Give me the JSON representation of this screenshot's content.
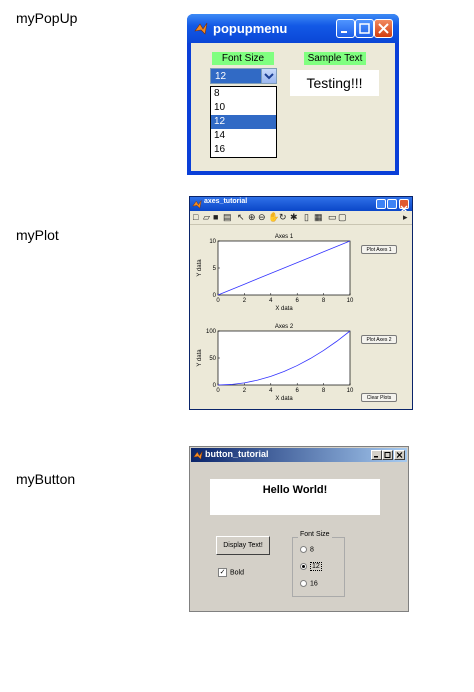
{
  "labels": {
    "popup": "myPopUp",
    "plot": "myPlot",
    "button": "myButton"
  },
  "popup_window": {
    "title": "popupmenu",
    "font_size_label": "Font Size",
    "sample_text_label": "Sample Text",
    "selected_value": "12",
    "options": [
      "8",
      "10",
      "12",
      "14",
      "16"
    ],
    "selected_index": 2,
    "sample_text": "Testing!!!"
  },
  "axes_window": {
    "title": "axes_tutorial",
    "axes1": {
      "title": "Axes 1",
      "xlabel": "X data",
      "ylabel": "Y data"
    },
    "axes2": {
      "title": "Axes 2",
      "xlabel": "X data",
      "ylabel": "Y data"
    },
    "buttons": {
      "plot1": "Plot Axes 1",
      "plot2": "Plot Axes 2",
      "clear": "Clear Plots"
    }
  },
  "chart_data": [
    {
      "type": "line",
      "title": "Axes 1",
      "xlabel": "X data",
      "ylabel": "Y data",
      "x": [
        0,
        1,
        2,
        3,
        4,
        5,
        6,
        7,
        8,
        9,
        10
      ],
      "series": [
        {
          "values": [
            0,
            1,
            2,
            3,
            4,
            5,
            6,
            7,
            8,
            9,
            10
          ]
        }
      ],
      "xlim": [
        0,
        10
      ],
      "ylim": [
        0,
        10
      ],
      "xticks": [
        0,
        2,
        4,
        6,
        8,
        10
      ],
      "yticks": [
        0,
        5,
        10
      ],
      "color": "#3333ff"
    },
    {
      "type": "line",
      "title": "Axes 2",
      "xlabel": "X data",
      "ylabel": "Y data",
      "x": [
        0,
        1,
        2,
        3,
        4,
        5,
        6,
        7,
        8,
        9,
        10
      ],
      "series": [
        {
          "values": [
            0,
            1,
            4,
            9,
            16,
            25,
            36,
            49,
            64,
            81,
            100
          ]
        }
      ],
      "xlim": [
        0,
        10
      ],
      "ylim": [
        0,
        100
      ],
      "xticks": [
        0,
        2,
        4,
        6,
        8,
        10
      ],
      "yticks": [
        0,
        50,
        100
      ],
      "color": "#3333ff"
    }
  ],
  "button_window": {
    "title": "button_tutorial",
    "hello_text": "Hello World!",
    "display_button": "Display Text!",
    "bold_label": "Bold",
    "bold_checked": true,
    "font_size_group": "Font Size",
    "radio_options": [
      "8",
      "12",
      "16"
    ],
    "radio_selected": 1
  }
}
